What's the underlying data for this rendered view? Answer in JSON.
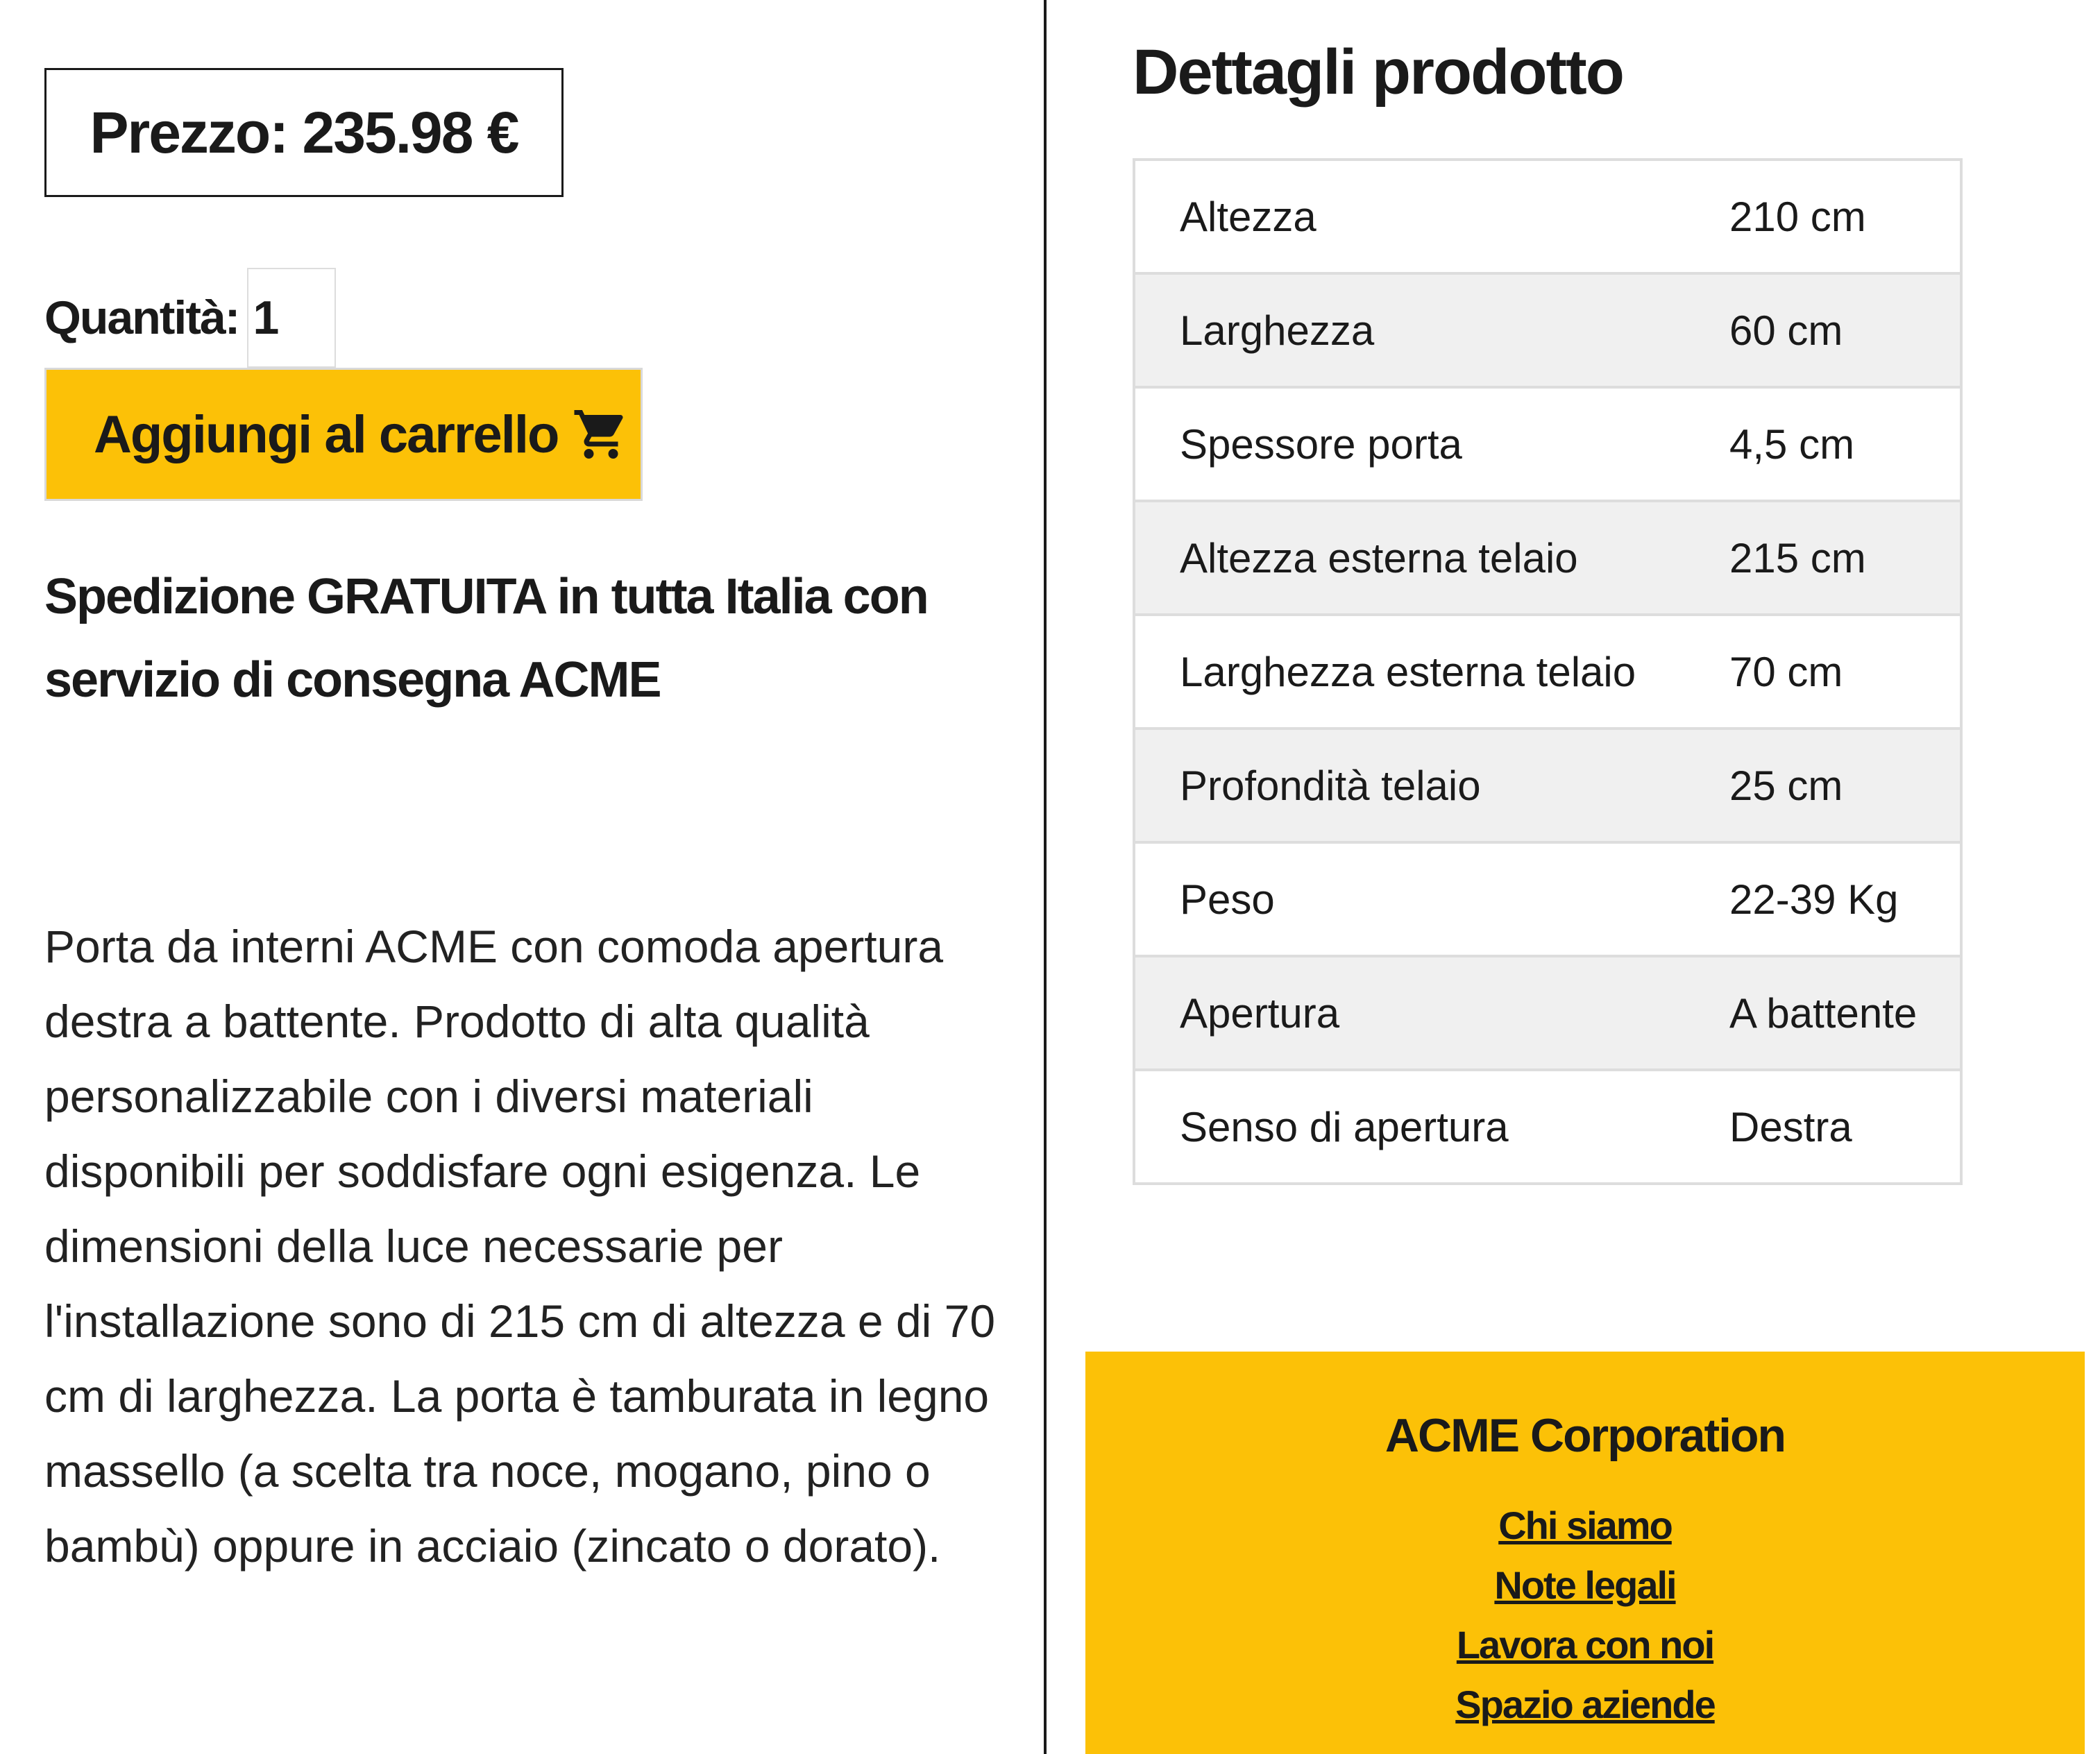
{
  "product": {
    "price_label": "Prezzo: 235.98 €",
    "quantity_label": "Quantità:",
    "quantity_value": "1",
    "add_to_cart_label": "Aggiungi al carrello",
    "cart_icon": "shopping-cart-icon",
    "shipping_text": "Spedizione GRATUITA in tutta Italia con servizio di consegna ACME",
    "description": "Porta da interni ACME con comoda apertura destra a battente. Prodotto di alta qualità personalizzabile con i diversi materiali disponibili per soddisfare ogni esigenza. Le dimensioni della luce necessarie per l'installazione sono di 215 cm di altezza e di 70 cm di larghezza. La porta è tamburata in legno massello (a scelta tra noce, mogano, pino o bambù) oppure in acciaio (zincato o dorato)."
  },
  "details": {
    "title": "Dettagli prodotto",
    "rows": [
      {
        "label": "Altezza",
        "value": "210 cm"
      },
      {
        "label": "Larghezza",
        "value": "60 cm"
      },
      {
        "label": "Spessore porta",
        "value": "4,5 cm"
      },
      {
        "label": "Altezza esterna telaio",
        "value": "215 cm"
      },
      {
        "label": "Larghezza esterna telaio",
        "value": "70 cm"
      },
      {
        "label": "Profondità telaio",
        "value": "25 cm"
      },
      {
        "label": "Peso",
        "value": "22-39 Kg"
      },
      {
        "label": "Apertura",
        "value": "A battente"
      },
      {
        "label": "Senso di apertura",
        "value": "Destra"
      }
    ]
  },
  "footer": {
    "company": "ACME Corporation",
    "links": [
      "Chi siamo",
      "Note legali",
      "Lavora con noi",
      "Spazio aziende"
    ]
  },
  "colors": {
    "accent": "#fcc107",
    "text": "#1a1a1a",
    "table_border": "#dddddd",
    "table_stripe": "#f0f0f0"
  }
}
